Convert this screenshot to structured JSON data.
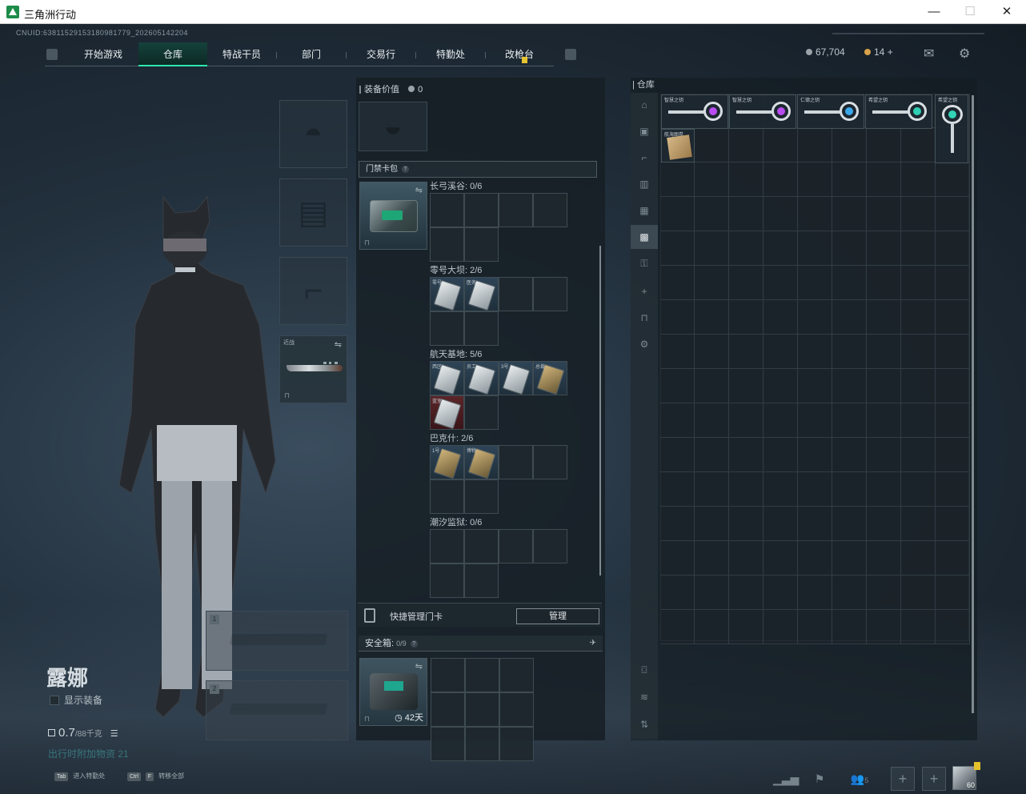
{
  "window": {
    "title": "三角洲行动",
    "minimize": "—",
    "maximize": "☐",
    "close": "✕"
  },
  "uid": "CNUID:63811529153180981779_202605142204",
  "nav": {
    "tabs": [
      "开始游戏",
      "仓库",
      "特战干员",
      "部门",
      "交易行",
      "特勤处",
      "改枪台"
    ],
    "active": "仓库"
  },
  "currency": {
    "coins": "67,704",
    "tickets": "14",
    "plus": "+"
  },
  "colors": {
    "accent": "#2ee6b0",
    "badge": "#e6c431"
  },
  "equipment": {
    "melee_label": "近战",
    "swap_icon": "⇋",
    "lock_icon": "🔒",
    "slot1": "1",
    "slot2": "2"
  },
  "character": {
    "name": "露娜",
    "show_gear": "显示装备",
    "weight": "0.7",
    "weight_max": "/88千克",
    "feature": "出行时附加物资 21"
  },
  "mid": {
    "equip_value_label": "装备价值",
    "equip_value": "0",
    "card_pack": "门禁卡包",
    "maps": [
      {
        "label": "长弓溪谷: 0/6",
        "cards": []
      },
      {
        "label": "零号大坝: 2/6",
        "cards": [
          {
            "name": "零号",
            "tone": "blue"
          },
          {
            "name": "医务",
            "tone": "blue"
          }
        ]
      },
      {
        "label": "航天基地: 5/6",
        "cards": [
          {
            "name": "西区",
            "tone": "blue"
          },
          {
            "name": "员工",
            "tone": "blue"
          },
          {
            "name": "3号",
            "tone": "blue"
          },
          {
            "name": "总裁",
            "tone": "gold"
          },
          {
            "name": "蓝室",
            "tone": "red"
          }
        ]
      },
      {
        "label": "巴克什: 2/6",
        "cards": [
          {
            "name": "1号",
            "tone": "gold"
          },
          {
            "name": "博物",
            "tone": "gold"
          }
        ]
      },
      {
        "label": "潮汐监狱: 0/6",
        "cards": []
      }
    ],
    "quick_manage": "快捷管理门卡",
    "manage_btn": "管理",
    "safe_label": "安全箱:",
    "safe_count": "0/9",
    "safe_days": "42天"
  },
  "stash": {
    "title": "仓库",
    "keys": [
      {
        "label": "智慧之钥",
        "gem": "#b84cf0"
      },
      {
        "label": "智慧之钥",
        "gem": "#b84cf0"
      },
      {
        "label": "仁德之钥",
        "gem": "#3aa7e8"
      },
      {
        "label": "希望之钥",
        "gem": "#2fcfb3"
      }
    ],
    "vertical_key": "希望之钥",
    "map_item": "航海图卷",
    "side_icons": [
      "hat-icon",
      "armor-icon",
      "gun-icon",
      "ammo-icon",
      "bag-icon",
      "stash-icon",
      "key-icon",
      "plus-icon",
      "lock-icon",
      "gear-icon",
      "camera-icon",
      "layers-icon",
      "sort-icon"
    ]
  },
  "footer": {
    "tab_key": "Tab",
    "tab_text": "进入特勤处",
    "ctrl_key": "Ctrl",
    "f_key": "F",
    "ctrl_text": "转移全部",
    "friends": "5",
    "level": "60"
  }
}
